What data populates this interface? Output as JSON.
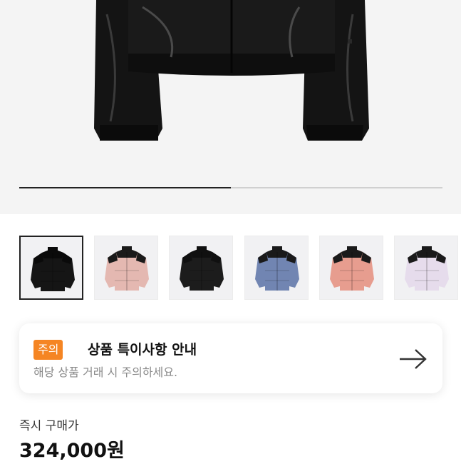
{
  "hero": {
    "image_alt": "black cropped puffer jacket",
    "carousel_progress": 0.5
  },
  "thumbnails": [
    {
      "name": "black-shiny",
      "colors": {
        "body": "#151515",
        "shoulder": "#0a0a0a"
      },
      "selected": true
    },
    {
      "name": "pink-black",
      "colors": {
        "body": "#e4b8b1",
        "shoulder": "#1a1a1a"
      },
      "selected": false
    },
    {
      "name": "black-matte",
      "colors": {
        "body": "#1c1c1c",
        "shoulder": "#101010"
      },
      "selected": false
    },
    {
      "name": "blue-black",
      "colors": {
        "body": "#7185b2",
        "shoulder": "#1a1a1a"
      },
      "selected": false
    },
    {
      "name": "salmon-black",
      "colors": {
        "body": "#e79d8f",
        "shoulder": "#1a1a1a"
      },
      "selected": false
    },
    {
      "name": "lavender-black",
      "colors": {
        "body": "#e6dcec",
        "shoulder": "#1a1a1a"
      },
      "selected": false
    }
  ],
  "notice": {
    "badge": "주의",
    "title": "상품 특이사항 안내",
    "subtitle": "해당 상품 거래 시 주의하세요.",
    "arrow_icon": "arrow-right-icon"
  },
  "price": {
    "label": "즉시 구매가",
    "value": "324,000원"
  }
}
